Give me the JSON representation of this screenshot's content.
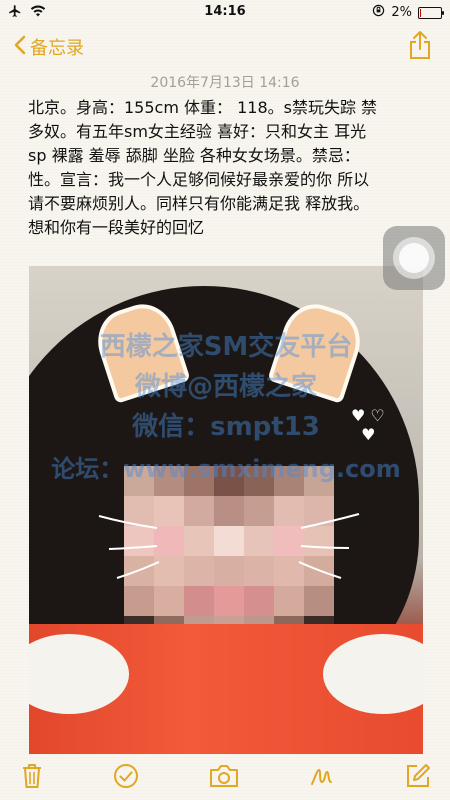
{
  "status": {
    "time": "14:16",
    "battery": "2%",
    "battery_level": 0.02
  },
  "nav": {
    "back_label": "备忘录",
    "accent": "#e1a722"
  },
  "note": {
    "date": "2016年7月13日 14:16",
    "lines": [
      "北京。身高：155cm 体重： 118。s禁玩失踪 禁",
      "多奴。有五年sm女主经验 喜好：只和女主 耳光",
      "sp 裸露 羞辱 舔脚 坐脸 各种女女场景。禁忌：",
      "性。宣言：我一个人足够伺候好最亲爱的你 所以",
      "请不要麻烦别人。同样只有你能满足我 释放我。",
      "想和你有一段美好的回忆"
    ]
  },
  "photo": {
    "watermark_lines": [
      "西檬之家SM交友平台",
      "微博@西檬之家",
      "微信：smpt13",
      "论坛：www.smximeng.com"
    ]
  },
  "toolbar": {
    "icons": [
      "trash-icon",
      "checkmark-icon",
      "camera-icon",
      "sketch-icon",
      "compose-icon"
    ]
  }
}
